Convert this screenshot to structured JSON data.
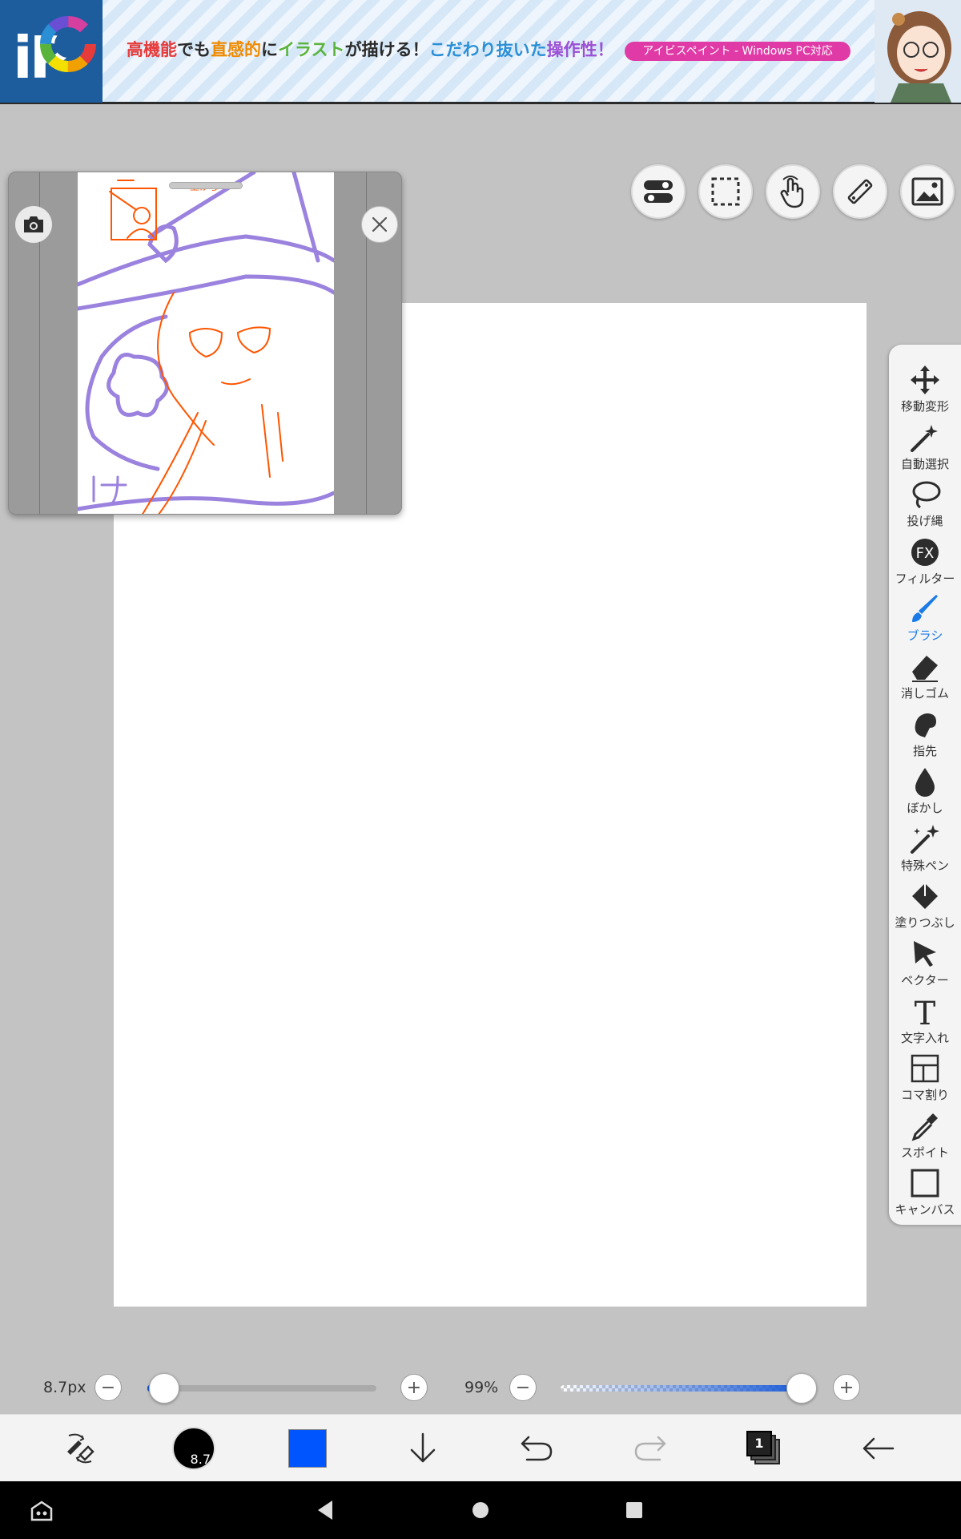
{
  "banner": {
    "logo_text": "iP",
    "headline_parts": [
      {
        "text": "高機能",
        "color": "r"
      },
      {
        "text": "でも",
        "color": "k"
      },
      {
        "text": "直感的",
        "color": "o"
      },
      {
        "text": "に",
        "color": "k"
      },
      {
        "text": "イラスト",
        "color": "g"
      },
      {
        "text": "が描ける！",
        "color": "k"
      },
      {
        "text": "こだわり抜いた",
        "color": "b"
      },
      {
        "text": "操作性！",
        "color": "p"
      }
    ],
    "badge": "アイビスペイント - Windows PC対応"
  },
  "top_tools": [
    {
      "name": "layer-toggle-icon"
    },
    {
      "name": "selection-icon"
    },
    {
      "name": "hand-gesture-icon"
    },
    {
      "name": "ruler-icon"
    },
    {
      "name": "image-icon"
    }
  ],
  "tools": [
    {
      "key": "move",
      "label": "移動変形",
      "icon": "move-icon"
    },
    {
      "key": "magic",
      "label": "自動選択",
      "icon": "magic-wand-icon"
    },
    {
      "key": "lasso",
      "label": "投げ縄",
      "icon": "lasso-icon"
    },
    {
      "key": "filter",
      "label": "フィルター",
      "icon": "fx-icon"
    },
    {
      "key": "brush",
      "label": "ブラシ",
      "icon": "brush-icon",
      "active": true
    },
    {
      "key": "eraser",
      "label": "消しゴム",
      "icon": "eraser-icon"
    },
    {
      "key": "smudge",
      "label": "指先",
      "icon": "smudge-icon"
    },
    {
      "key": "blur",
      "label": "ぼかし",
      "icon": "blur-drop-icon"
    },
    {
      "key": "special",
      "label": "特殊ペン",
      "icon": "special-pen-icon"
    },
    {
      "key": "fill",
      "label": "塗りつぶし",
      "icon": "fill-bucket-icon"
    },
    {
      "key": "vector",
      "label": "ベクター",
      "icon": "vector-cursor-icon"
    },
    {
      "key": "text",
      "label": "文字入れ",
      "icon": "text-icon"
    },
    {
      "key": "frame",
      "label": "コマ割り",
      "icon": "frame-divider-icon"
    },
    {
      "key": "eyedropper",
      "label": "スポイト",
      "icon": "eyedropper-icon"
    },
    {
      "key": "canvas",
      "label": "キャンバス",
      "icon": "canvas-icon"
    }
  ],
  "brush": {
    "size_label": "8.7px",
    "size_value": 8.7,
    "size_fraction": 0.02,
    "opacity_label": "99%",
    "opacity_fraction": 0.99,
    "minus": "−",
    "plus": "+"
  },
  "toolbar": {
    "brush_size_badge": "8.7",
    "current_color": "#0055ff",
    "layer_count": "1"
  },
  "artwork": {
    "purple": "#9a82de",
    "orange": "#ff5500",
    "thumb_note": "上から"
  }
}
